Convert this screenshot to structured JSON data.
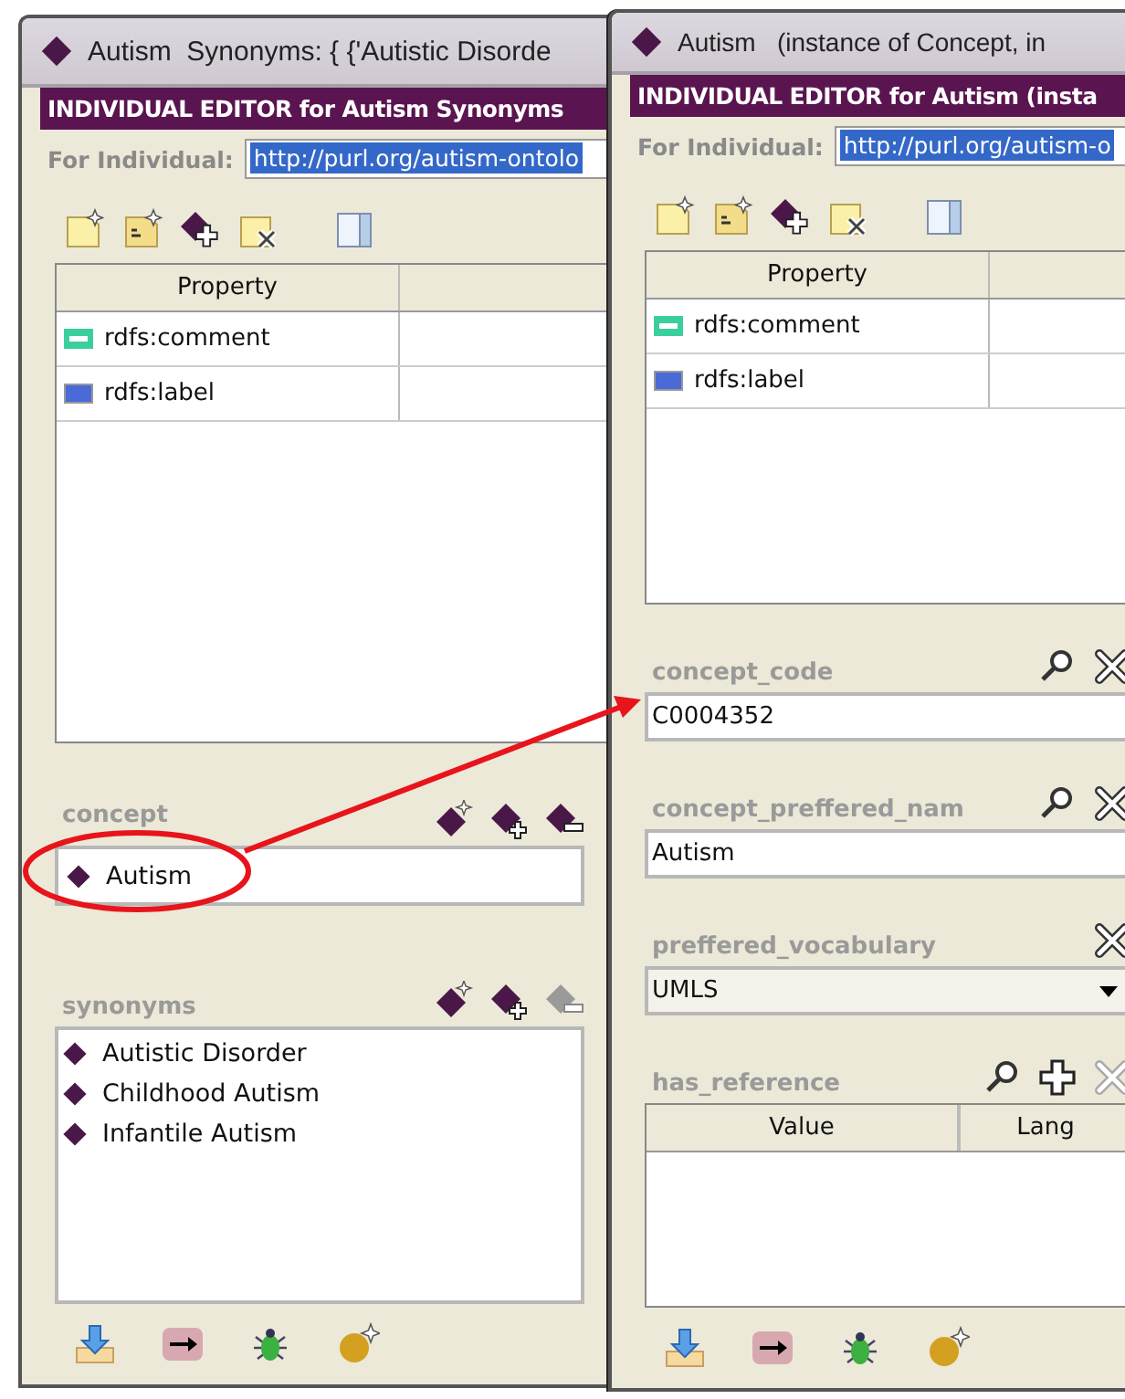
{
  "windows": [
    {
      "title": "Autism  Synonyms: { {'Autistic Disorde",
      "editor_header": "INDIVIDUAL EDITOR for Autism Synonyms",
      "for_individual_label": "For Individual:",
      "uri": "http://purl.org/autism-ontolo",
      "property_table": {
        "columns": [
          "Property"
        ],
        "rows": [
          {
            "property": "rdfs:comment",
            "kind": "annotation"
          },
          {
            "property": "rdfs:label",
            "kind": "label"
          }
        ]
      },
      "widgets": [
        {
          "kind": "instance",
          "label": "concept",
          "items": [
            "Autism"
          ],
          "remove_disabled": false
        },
        {
          "kind": "instances",
          "label": "synonyms",
          "items": [
            "Autistic Disorder",
            "Childhood Autism",
            "Infantile Autism"
          ],
          "remove_disabled": true
        }
      ]
    },
    {
      "title": "Autism   (instance of Concept, in",
      "editor_header": "INDIVIDUAL EDITOR for Autism  (insta",
      "for_individual_label": "For Individual:",
      "uri": "http://purl.org/autism-o",
      "property_table": {
        "columns": [
          "Property"
        ],
        "rows": [
          {
            "property": "rdfs:comment",
            "kind": "annotation"
          },
          {
            "property": "rdfs:label",
            "kind": "label"
          }
        ]
      },
      "widgets": [
        {
          "kind": "text",
          "label": "concept_code",
          "value": "C0004352"
        },
        {
          "kind": "text",
          "label": "concept_preffered_nam",
          "value": "Autism"
        },
        {
          "kind": "combo",
          "label": "preffered_vocabulary",
          "value": "UMLS"
        },
        {
          "kind": "table",
          "label": "has_reference",
          "columns": [
            "Value",
            "Lang"
          ],
          "delete_disabled": true
        }
      ]
    }
  ]
}
